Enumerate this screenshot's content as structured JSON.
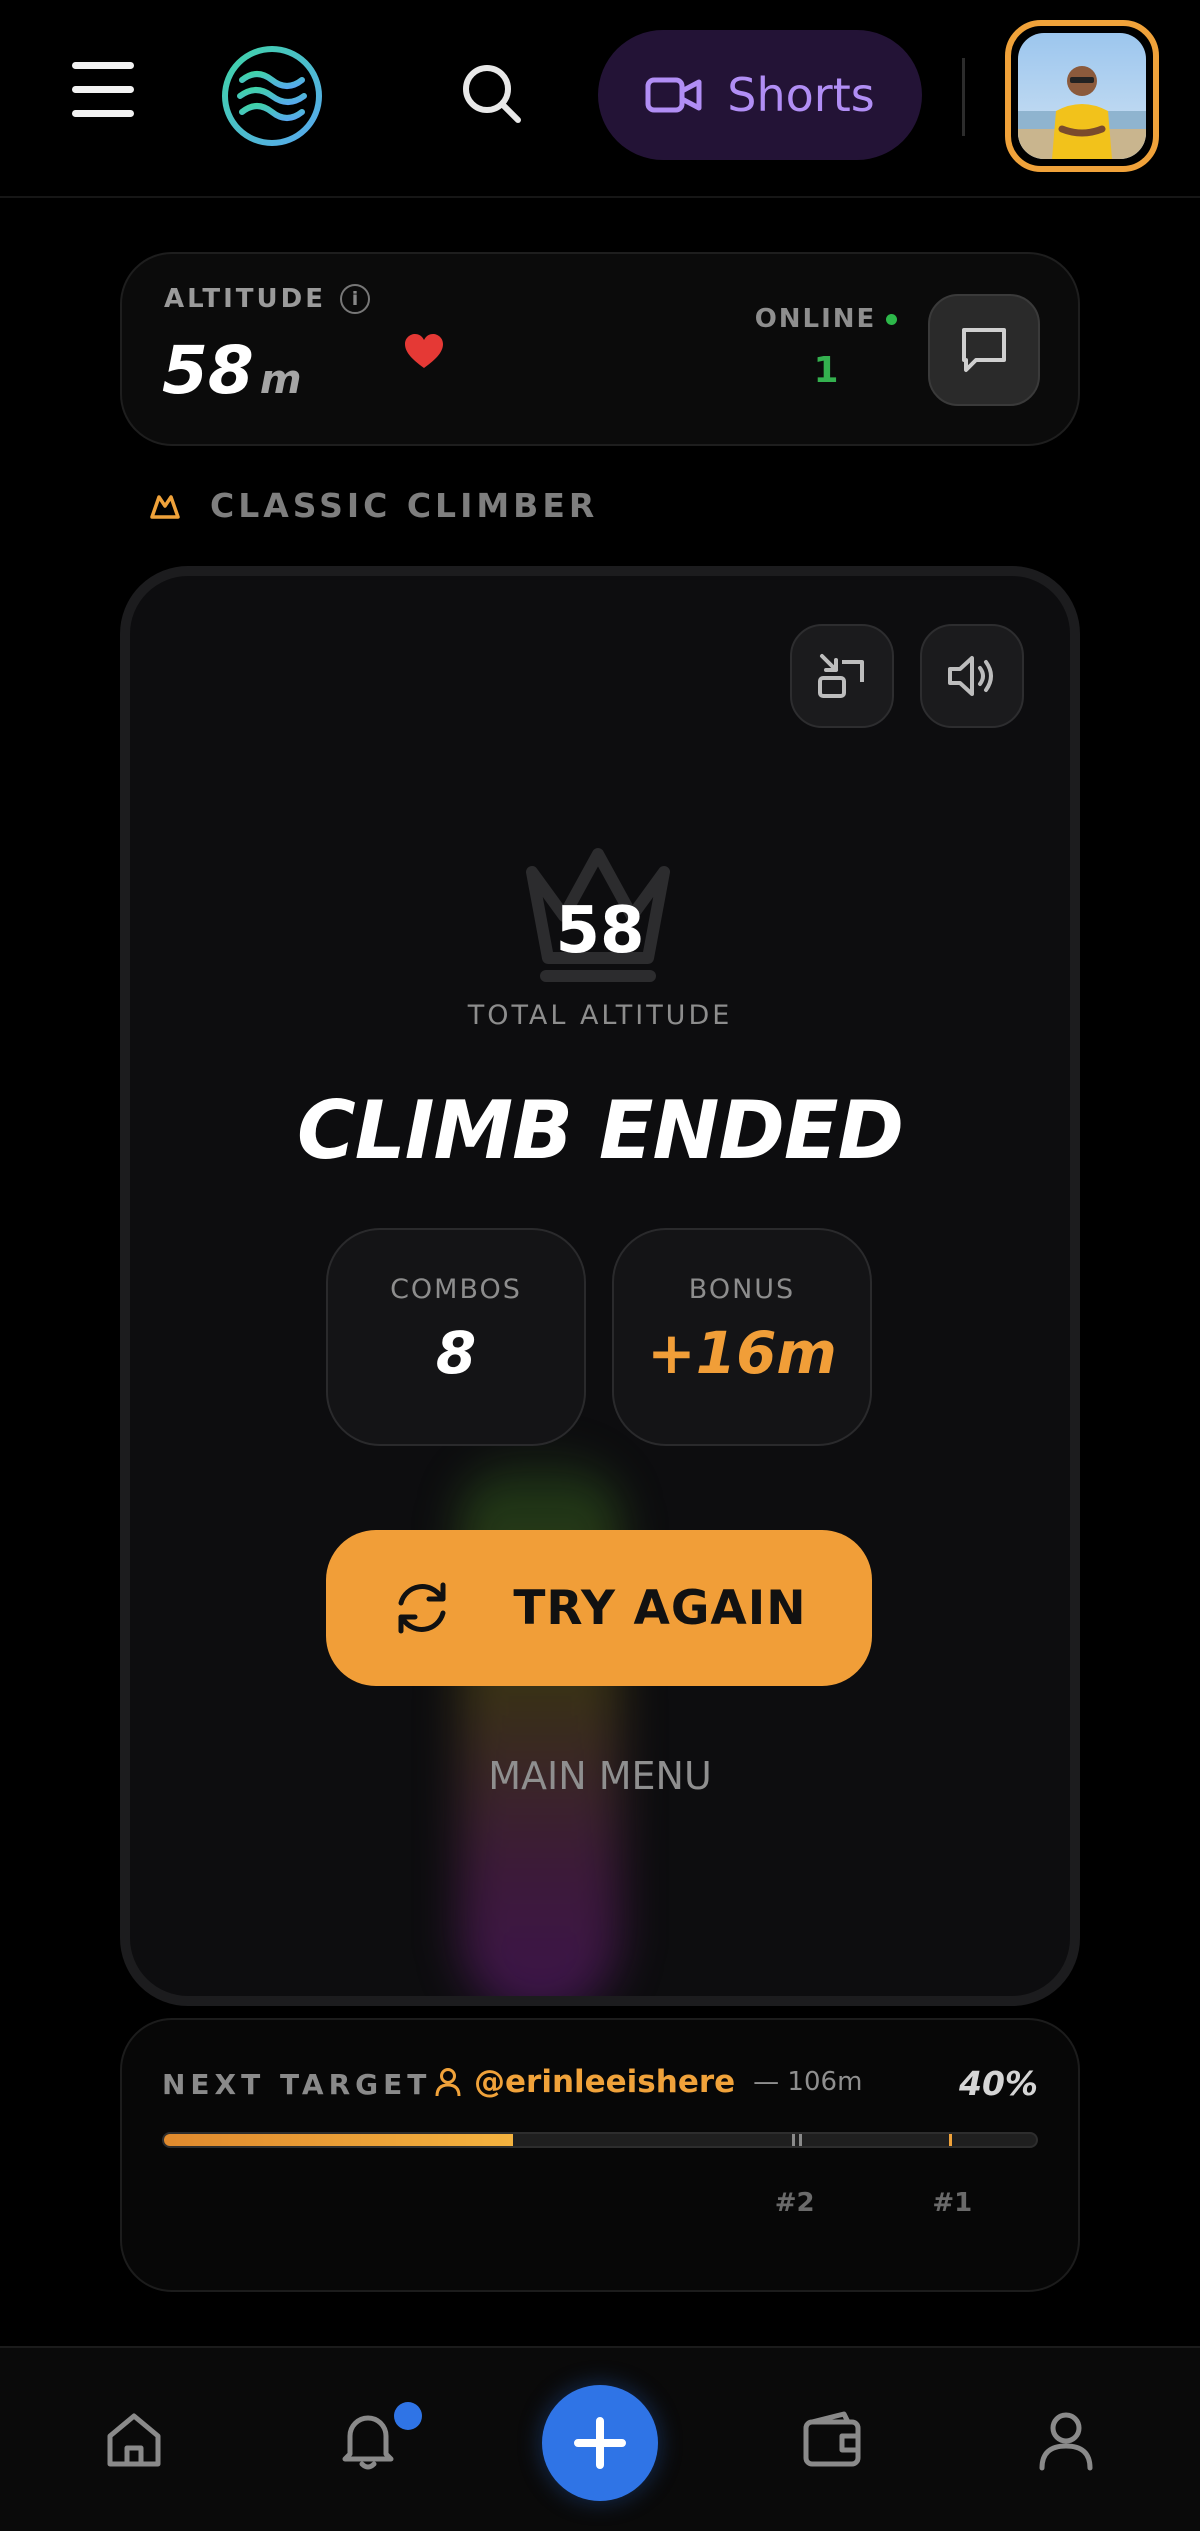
{
  "header": {
    "menu_icon": "hamburger-menu-icon",
    "logo_icon": "waves-logo-icon",
    "search_icon": "search-icon",
    "shorts_label": "Shorts",
    "shorts_icon": "video-camera-icon",
    "accent_color": "#b18ef5"
  },
  "status": {
    "altitude_label": "ALTITUDE",
    "altitude_value": "58",
    "altitude_unit": "m",
    "online_label": "ONLINE",
    "online_count": "1",
    "heart_color": "#e53935",
    "online_color": "#34b14f"
  },
  "mode": {
    "label": "CLASSIC CLIMBER",
    "icon": "mountain-icon"
  },
  "game": {
    "score": "58",
    "score_label": "TOTAL ALTITUDE",
    "title": "CLIMB ENDED",
    "stats": [
      {
        "label": "COMBOS",
        "value": "8",
        "color": "#ffffff"
      },
      {
        "label": "BONUS",
        "value": "+16m",
        "color": "#f19e38"
      }
    ],
    "try_again_label": "TRY AGAIN",
    "main_menu_label": "MAIN MENU",
    "primary_color": "#f19e38"
  },
  "next_target": {
    "label": "NEXT TARGET",
    "username": "@erinleeishere",
    "distance": "— 106m",
    "percent_label": "40%",
    "progress": 0.4,
    "markers": [
      {
        "label": "#2",
        "position": 0.72
      },
      {
        "label": "#1",
        "position": 0.9
      }
    ]
  },
  "bottom_nav": {
    "items": [
      "home-icon",
      "bell-icon",
      "add-icon",
      "wallet-icon",
      "profile-icon"
    ],
    "fab_color": "#2f74e6"
  }
}
